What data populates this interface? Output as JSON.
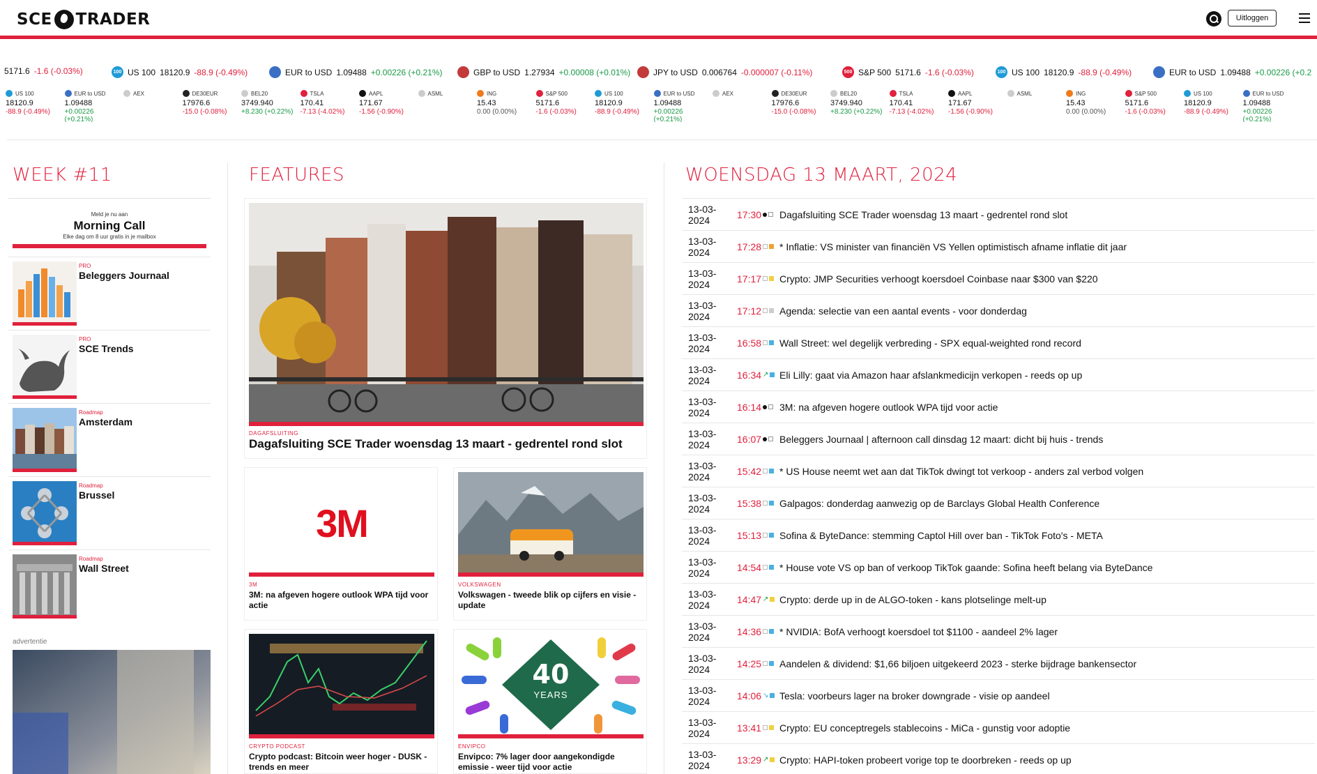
{
  "header": {
    "logo_left": "SCE",
    "logo_right": "TRADER",
    "logout_label": "Uitloggen"
  },
  "ticker": [
    {
      "name": "",
      "price": "5171.6",
      "change": "-1.6 (-0.03%)",
      "dir": "neg",
      "badge": "",
      "badge_color": ""
    },
    {
      "name": "US 100",
      "price": "18120.9",
      "change": "-88.9 (-0.49%)",
      "dir": "neg",
      "badge": "100",
      "badge_color": "#1e9bd6"
    },
    {
      "name": "EUR to USD",
      "price": "1.09488",
      "change": "+0.00226 (+0.21%)",
      "dir": "pos",
      "badge": "",
      "badge_color": "#3a6fc4"
    },
    {
      "name": "GBP to USD",
      "price": "1.27934",
      "change": "+0.00008 (+0.01%)",
      "dir": "pos",
      "badge": "",
      "badge_color": "#c23a3a"
    },
    {
      "name": "JPY to USD",
      "price": "0.006764",
      "change": "-0.000007 (-0.11%)",
      "dir": "neg",
      "badge": "",
      "badge_color": "#c23a3a"
    },
    {
      "name": "S&P 500",
      "price": "5171.6",
      "change": "-1.6 (-0.03%)",
      "dir": "neg",
      "badge": "500",
      "badge_color": "#e0203c"
    },
    {
      "name": "US 100",
      "price": "18120.9",
      "change": "-88.9 (-0.49%)",
      "dir": "neg",
      "badge": "100",
      "badge_color": "#1e9bd6"
    },
    {
      "name": "EUR to USD",
      "price": "1.09488",
      "change": "+0.00226 (+0.2",
      "dir": "pos",
      "badge": "",
      "badge_color": "#3a6fc4"
    }
  ],
  "widget": [
    {
      "name": "US 100",
      "price": "18120.9",
      "change": "-88.9 (-0.49%)",
      "dir": "neg",
      "color": "#1e9bd6"
    },
    {
      "name": "EUR to USD",
      "price": "1.09488",
      "change": "+0.00226 (+0.21%)",
      "dir": "pos",
      "color": "#3a6fc4"
    },
    {
      "name": "AEX",
      "price": "",
      "change": "",
      "dir": "",
      "color": "#ccc"
    },
    {
      "name": "DE30EUR",
      "price": "17976.6",
      "change": "-15.0 (-0.08%)",
      "dir": "neg",
      "color": "#222"
    },
    {
      "name": "BEL20",
      "price": "3749.940",
      "change": "+8.230 (+0.22%)",
      "dir": "pos",
      "color": "#ccc"
    },
    {
      "name": "TSLA",
      "price": "170.41",
      "change": "-7.13 (-4.02%)",
      "dir": "neg",
      "color": "#e0203c"
    },
    {
      "name": "AAPL",
      "price": "171.67",
      "change": "-1.56 (-0.90%)",
      "dir": "neg",
      "color": "#111"
    },
    {
      "name": "ASML",
      "price": "",
      "change": "",
      "dir": "",
      "color": "#ccc"
    },
    {
      "name": "ING",
      "price": "15.43",
      "change": "0.00 (0.00%)",
      "dir": "",
      "color": "#f07a1a"
    },
    {
      "name": "S&P 500",
      "price": "5171.6",
      "change": "-1.6 (-0.03%)",
      "dir": "neg",
      "color": "#e0203c"
    },
    {
      "name": "US 100",
      "price": "18120.9",
      "change": "-88.9 (-0.49%)",
      "dir": "neg",
      "color": "#1e9bd6"
    },
    {
      "name": "EUR to USD",
      "price": "1.09488",
      "change": "+0.00226 (+0.21%)",
      "dir": "pos",
      "color": "#3a6fc4"
    },
    {
      "name": "AEX",
      "price": "",
      "change": "",
      "dir": "",
      "color": "#ccc"
    },
    {
      "name": "DE30EUR",
      "price": "17976.6",
      "change": "-15.0 (-0.08%)",
      "dir": "neg",
      "color": "#222"
    },
    {
      "name": "BEL20",
      "price": "3749.940",
      "change": "+8.230 (+0.22%)",
      "dir": "pos",
      "color": "#ccc"
    },
    {
      "name": "TSLA",
      "price": "170.41",
      "change": "-7.13 (-4.02%)",
      "dir": "neg",
      "color": "#e0203c"
    },
    {
      "name": "AAPL",
      "price": "171.67",
      "change": "-1.56 (-0.90%)",
      "dir": "neg",
      "color": "#111"
    },
    {
      "name": "ASML",
      "price": "",
      "change": "",
      "dir": "",
      "color": "#ccc"
    },
    {
      "name": "ING",
      "price": "15.43",
      "change": "0.00 (0.00%)",
      "dir": "",
      "color": "#f07a1a"
    },
    {
      "name": "S&P 500",
      "price": "5171.6",
      "change": "-1.6 (-0.03%)",
      "dir": "neg",
      "color": "#e0203c"
    },
    {
      "name": "US 100",
      "price": "18120.9",
      "change": "-88.9 (-0.49%)",
      "dir": "neg",
      "color": "#1e9bd6"
    },
    {
      "name": "EUR to USD",
      "price": "1.09488",
      "change": "+0.00226 (+0.21%)",
      "dir": "pos",
      "color": "#3a6fc4"
    }
  ],
  "columns": {
    "week": "WEEK #11",
    "features": "FEATURES",
    "date": "WOENSDAG 13 MAART, 2024"
  },
  "morning_call": {
    "line1": "Meld je nu aan",
    "line2": "Morning Call",
    "line3": "Elke dag om 8 uur gratis in je mailbox"
  },
  "left_cards": [
    {
      "tag": "PRO",
      "title": "Beleggers Journaal"
    },
    {
      "tag": "PRO",
      "title": "SCE Trends"
    },
    {
      "tag": "Roadmap",
      "title": "Amsterdam"
    },
    {
      "tag": "Roadmap",
      "title": "Brussel"
    },
    {
      "tag": "Roadmap",
      "title": "Wall Street"
    }
  ],
  "ad_label": "advertentie",
  "features": {
    "main": {
      "tag": "DAGAFSLUITING",
      "title": "Dagafsluiting SCE Trader woensdag 13 maart - gedrentel rond slot"
    },
    "cards": [
      {
        "tag": "3M",
        "title": "3M: na afgeven hogere outlook WPA tijd voor actie",
        "logo": "3M"
      },
      {
        "tag": "VOLKSWAGEN",
        "title": "Volkswagen - tweede blik op cijfers en visie - update"
      },
      {
        "tag": "CRYPTO PODCAST",
        "title": "Crypto podcast: Bitcoin weer hoger - DUSK - trends en meer"
      },
      {
        "tag": "ENVIPCO",
        "title": "Envipco: 7% lager door aangekondigde emissie - weer tijd voor actie",
        "badge_number": "40",
        "badge_text": "YEARS"
      }
    ]
  },
  "news_date": "13-03-2024",
  "news": [
    {
      "time": "17:30",
      "icon": "dot",
      "title": "Dagafsluiting SCE Trader woensdag 13 maart - gedrentel rond slot"
    },
    {
      "time": "17:28",
      "icon": "orange",
      "title": "* Inflatie: VS minister van financiën VS Yellen optimistisch afname inflatie dit jaar"
    },
    {
      "time": "17:17",
      "icon": "yellow",
      "title": "Crypto: JMP Securities verhoogt koersdoel Coinbase naar $300 van $220"
    },
    {
      "time": "17:12",
      "icon": "none",
      "title": "Agenda: selectie van een aantal events - voor donderdag"
    },
    {
      "time": "16:58",
      "icon": "blue",
      "title": "Wall Street: wel degelijk verbreding - SPX equal-weighted rond record"
    },
    {
      "time": "16:34",
      "icon": "up",
      "title": "Eli Lilly: gaat via Amazon haar afslankmedicijn verkopen - reeds op up"
    },
    {
      "time": "16:14",
      "icon": "dot",
      "title": "3M: na afgeven hogere outlook WPA tijd voor actie"
    },
    {
      "time": "16:07",
      "icon": "dot",
      "title": "Beleggers Journaal | afternoon call dinsdag 12 maart: dicht bij huis - trends"
    },
    {
      "time": "15:42",
      "icon": "blue",
      "title": "* US House neemt wet aan dat TikTok dwingt tot verkoop - anders zal verbod volgen"
    },
    {
      "time": "15:38",
      "icon": "blue",
      "title": "Galpagos: donderdag aanwezig op de Barclays Global Health Conference"
    },
    {
      "time": "15:13",
      "icon": "blue",
      "title": "Sofina & ByteDance: stemming Captol Hill over ban - TikTok Foto's - META"
    },
    {
      "time": "14:54",
      "icon": "blue",
      "title": "* House vote VS op ban of verkoop TikTok gaande: Sofina heeft belang via ByteDance"
    },
    {
      "time": "14:47",
      "icon": "up-yellow",
      "title": "Crypto: derde up in de ALGO-token - kans plotselinge melt-up"
    },
    {
      "time": "14:36",
      "icon": "blue",
      "title": "* NVIDIA: BofA verhoogt koersdoel tot $1100 - aandeel 2% lager"
    },
    {
      "time": "14:25",
      "icon": "blue",
      "title": "Aandelen & dividend: $1,66 biljoen uitgekeerd 2023 - sterke bijdrage bankensector"
    },
    {
      "time": "14:06",
      "icon": "down",
      "title": "Tesla: voorbeurs lager na broker downgrade - visie op aandeel"
    },
    {
      "time": "13:41",
      "icon": "yellow",
      "title": "Crypto: EU conceptregels stablecoins - MiCa - gunstig voor adoptie"
    },
    {
      "time": "13:29",
      "icon": "up-yellow",
      "title": "Crypto: HAPI-token probeert vorige top te doorbreken - reeds op up"
    }
  ]
}
